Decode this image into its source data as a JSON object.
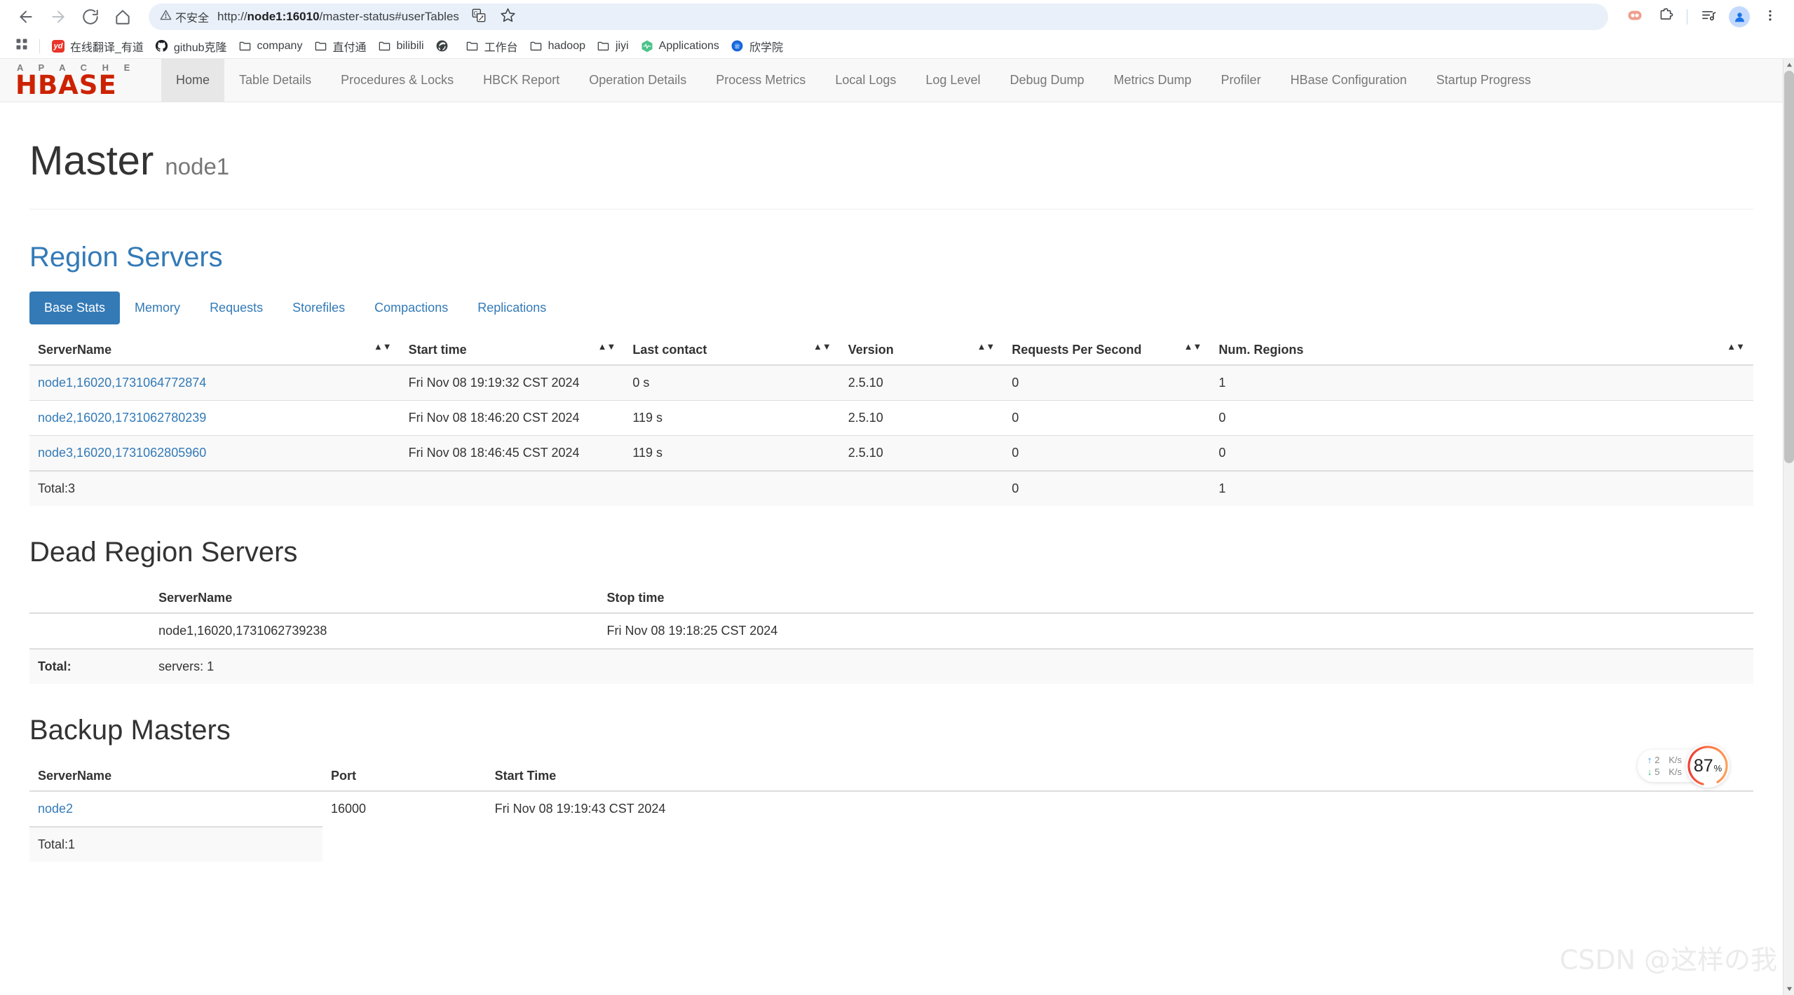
{
  "browser": {
    "back_icon": "back-arrow-icon",
    "forward_icon": "forward-arrow-icon",
    "reload_icon": "reload-icon",
    "home_icon": "home-icon",
    "security_label": "不安全",
    "url_host": "node1:16010",
    "url_scheme": "http://",
    "url_path": "/master-status#userTables",
    "url_full": "http://node1:16010/master-status#userTables",
    "toolbar_icons": [
      "translate-icon",
      "bookmark-star-icon",
      "extension-pill-icon",
      "puzzle-extensions-icon",
      "media-playlist-icon",
      "profile-avatar-icon",
      "three-dot-menu-icon"
    ]
  },
  "bookmarks": {
    "apps_icon": "apps-grid-icon",
    "items": [
      {
        "label": "在线翻译_有道",
        "icon": "youdao-icon"
      },
      {
        "label": "github克隆",
        "icon": "github-icon"
      },
      {
        "label": "company",
        "icon": "folder-icon"
      },
      {
        "label": "直付通",
        "icon": "folder-icon"
      },
      {
        "label": "bilibili",
        "icon": "folder-icon"
      },
      {
        "label": "",
        "icon": "globe-icon"
      },
      {
        "label": "工作台",
        "icon": "folder-icon"
      },
      {
        "label": "hadoop",
        "icon": "folder-icon"
      },
      {
        "label": "jiyi",
        "icon": "folder-icon"
      },
      {
        "label": "Applications",
        "icon": "apps-hex-icon"
      },
      {
        "label": "欣学院",
        "icon": "blue-circle-icon"
      }
    ]
  },
  "hbase_nav": {
    "brand_top": "A P A C H E",
    "brand_main": "HBASE",
    "items": [
      {
        "label": "Home",
        "active": true
      },
      {
        "label": "Table Details",
        "active": false
      },
      {
        "label": "Procedures & Locks",
        "active": false
      },
      {
        "label": "HBCK Report",
        "active": false
      },
      {
        "label": "Operation Details",
        "active": false
      },
      {
        "label": "Process Metrics",
        "active": false
      },
      {
        "label": "Local Logs",
        "active": false
      },
      {
        "label": "Log Level",
        "active": false
      },
      {
        "label": "Debug Dump",
        "active": false
      },
      {
        "label": "Metrics Dump",
        "active": false
      },
      {
        "label": "Profiler",
        "active": false
      },
      {
        "label": "HBase Configuration",
        "active": false
      },
      {
        "label": "Startup Progress",
        "active": false
      }
    ]
  },
  "page": {
    "title": "Master",
    "title_sub": "node1"
  },
  "region_servers": {
    "heading": "Region Servers",
    "tabs": [
      {
        "label": "Base Stats",
        "active": true
      },
      {
        "label": "Memory",
        "active": false
      },
      {
        "label": "Requests",
        "active": false
      },
      {
        "label": "Storefiles",
        "active": false
      },
      {
        "label": "Compactions",
        "active": false
      },
      {
        "label": "Replications",
        "active": false
      }
    ],
    "columns": [
      "ServerName",
      "Start time",
      "Last contact",
      "Version",
      "Requests Per Second",
      "Num. Regions"
    ],
    "rows": [
      {
        "server_name": "node1,16020,1731064772874",
        "start_time": "Fri Nov 08 19:19:32 CST 2024",
        "last_contact": "0 s",
        "version": "2.5.10",
        "requests_per_second": "0",
        "num_regions": "1"
      },
      {
        "server_name": "node2,16020,1731062780239",
        "start_time": "Fri Nov 08 18:46:20 CST 2024",
        "last_contact": "119 s",
        "version": "2.5.10",
        "requests_per_second": "0",
        "num_regions": "0"
      },
      {
        "server_name": "node3,16020,1731062805960",
        "start_time": "Fri Nov 08 18:46:45 CST 2024",
        "last_contact": "119 s",
        "version": "2.5.10",
        "requests_per_second": "0",
        "num_regions": "0"
      }
    ],
    "total": {
      "label": "Total:3",
      "start_time": "",
      "last_contact": "",
      "version": "",
      "requests_per_second": "0",
      "num_regions": "1"
    }
  },
  "dead_region_servers": {
    "heading": "Dead Region Servers",
    "columns": [
      "",
      "ServerName",
      "Stop time"
    ],
    "rows": [
      {
        "blank": "",
        "server_name": "node1,16020,1731062739238",
        "stop_time": "Fri Nov 08 19:18:25 CST 2024"
      }
    ],
    "total": {
      "label": "Total:",
      "value": "servers: 1",
      "stop_time": ""
    }
  },
  "backup_masters": {
    "heading": "Backup Masters",
    "columns": [
      "ServerName",
      "Port",
      "Start Time"
    ],
    "rows": [
      {
        "server_name": "node2",
        "port": "16000",
        "start_time": "Fri Nov 08 19:19:43 CST 2024"
      }
    ],
    "total": {
      "label": "Total:1",
      "port": "",
      "start_time": ""
    }
  },
  "net_widget": {
    "upload_value": "2",
    "upload_unit": "K/s",
    "download_value": "5",
    "download_unit": "K/s",
    "percent": "87",
    "percent_sign": "%",
    "ring_color_start": "#ff9a4d",
    "ring_color_end": "#f0453a",
    "upload_color": "#3a8ee6",
    "download_color": "#2eb872"
  },
  "watermark": {
    "text": "CSDN @这样の我"
  },
  "colors": {
    "accent_blue": "#337ab7",
    "hbase_red": "#cc2200",
    "link_blue": "#337ab7"
  }
}
